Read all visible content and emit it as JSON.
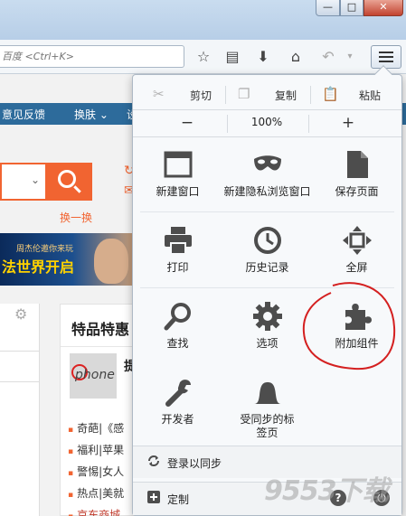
{
  "browser": {
    "url_placeholder": "百度 <Ctrl+K>",
    "window_buttons": {
      "minimize": "—",
      "maximize": "□",
      "close": "✕"
    }
  },
  "page": {
    "nav_items": [
      "意见反馈",
      "换肤 ⌄",
      "设"
    ],
    "search_refresh": "换一换",
    "banner_line1": "周杰伦邀你来玩",
    "banner_line2": "法世界开启",
    "right_card_title": "特品特惠",
    "right_card_headline": "提",
    "right_card_thumb_text": "phone",
    "news_items": [
      "奇葩|《感",
      "福利|苹果",
      "警惕|女人",
      "热点|美就",
      "京东商城"
    ],
    "left_items": [
      "",
      "",
      "",
      "",
      ""
    ]
  },
  "menu": {
    "edit": [
      {
        "label": "剪切",
        "icon": "cut-icon"
      },
      {
        "label": "复制",
        "icon": "copy-icon"
      },
      {
        "label": "粘贴",
        "icon": "paste-icon"
      }
    ],
    "zoom": {
      "out": "−",
      "value": "100%",
      "in": "+"
    },
    "items": [
      {
        "label": "新建窗口",
        "icon": "new-window-icon"
      },
      {
        "label": "新建隐私浏览窗口",
        "icon": "private-mask-icon"
      },
      {
        "label": "保存页面",
        "icon": "save-page-icon"
      },
      {
        "label": "打印",
        "icon": "print-icon"
      },
      {
        "label": "历史记录",
        "icon": "history-icon"
      },
      {
        "label": "全屏",
        "icon": "fullscreen-icon"
      },
      {
        "label": "查找",
        "icon": "find-icon"
      },
      {
        "label": "选项",
        "icon": "options-gear-icon"
      },
      {
        "label": "附加组件",
        "icon": "addons-puzzle-icon"
      },
      {
        "label": "开发者",
        "icon": "developer-wrench-icon"
      },
      {
        "label": "受同步的标签页",
        "icon": "synced-tabs-icon"
      }
    ],
    "sync_label": "登录以同步",
    "customize_label": "定制",
    "help_label": "?"
  },
  "watermark": "9553下载",
  "colors": {
    "accent_orange": "#f16431",
    "site_nav_blue": "#2d6b9b",
    "annotation_red": "#d42020"
  }
}
